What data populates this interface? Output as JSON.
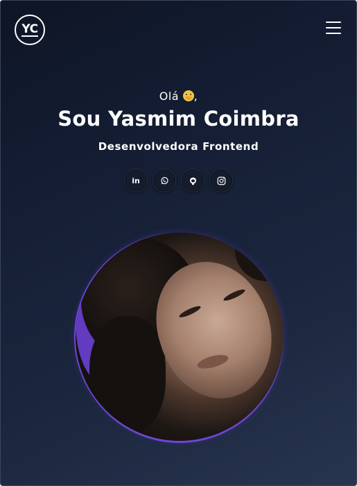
{
  "header": {
    "logo_text": "YC",
    "menu_icon": "hamburger-menu-icon"
  },
  "hero": {
    "greeting": "Olá",
    "greeting_emoji": "hugging-face-emoji",
    "greeting_suffix": ",",
    "name": "Sou Yasmim Coimbra",
    "role": "Desenvolvedora Frontend"
  },
  "socials": [
    {
      "icon": "linkedin-icon",
      "label": "in"
    },
    {
      "icon": "whatsapp-icon"
    },
    {
      "icon": "github-icon"
    },
    {
      "icon": "instagram-icon"
    }
  ],
  "profile_photo": {
    "accent_color": "#6e46d6"
  },
  "colors": {
    "background_top": "#0e1526",
    "background_bottom": "#28354e",
    "text": "#ffffff"
  }
}
